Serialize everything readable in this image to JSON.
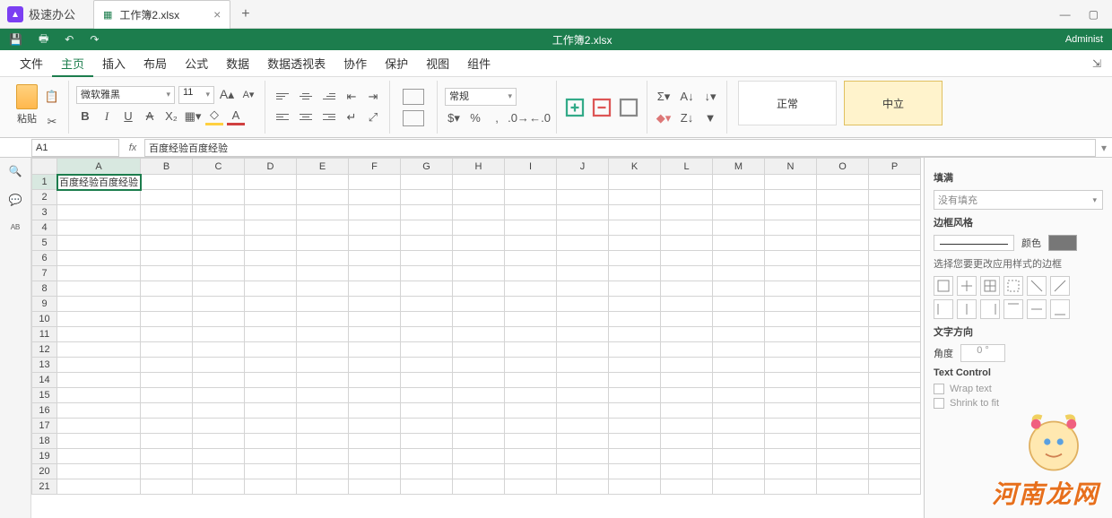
{
  "app": {
    "name": "极速办公"
  },
  "tab": {
    "label": "工作簿2.xlsx",
    "icon_name": "spreadsheet-icon"
  },
  "green_bar": {
    "title": "工作簿2.xlsx",
    "user": "Administ"
  },
  "menu": {
    "items": [
      "文件",
      "主页",
      "插入",
      "布局",
      "公式",
      "数据",
      "数据透视表",
      "协作",
      "保护",
      "视图",
      "组件"
    ],
    "active_index": 1
  },
  "ribbon": {
    "paste_label": "粘贴",
    "font_name": "微软雅黑",
    "font_size": "11",
    "number_format": "常规",
    "style_normal": "正常",
    "style_neutral": "中立"
  },
  "formula_bar": {
    "cell_ref": "A1",
    "fx": "fx",
    "content": "百度经验百度经验"
  },
  "sheet": {
    "columns": [
      "A",
      "B",
      "C",
      "D",
      "E",
      "F",
      "G",
      "H",
      "I",
      "J",
      "K",
      "L",
      "M",
      "N",
      "O",
      "P"
    ],
    "row_count": 21,
    "active_row": 1,
    "active_col": "A",
    "cells": {
      "A1": "百度经验百度经验"
    }
  },
  "right_panel": {
    "fill_title": "填满",
    "fill_value": "没有填充",
    "border_title": "边框风格",
    "color_label": "颜色",
    "border_hint": "选择您要更改应用样式的边框",
    "text_dir_title": "文字方向",
    "angle_label": "角度",
    "angle_value": "0 °",
    "text_control_title": "Text Control",
    "wrap_label": "Wrap text",
    "shrink_label": "Shrink to fit"
  },
  "watermark": "河南龙网"
}
